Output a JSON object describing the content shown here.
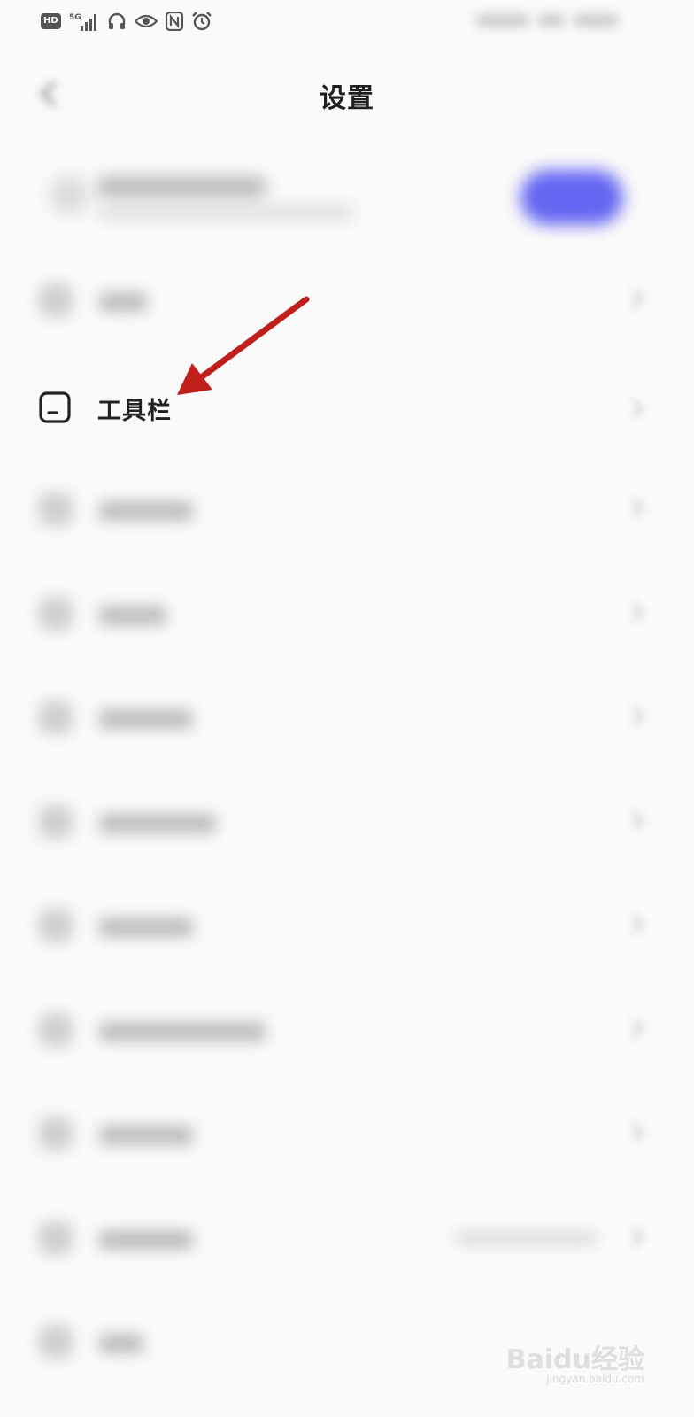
{
  "status_bar": {
    "hd_badge": "HD",
    "network_label": "5G",
    "icons": [
      "hd-icon",
      "signal-5g-icon",
      "headphones-icon",
      "eye-icon",
      "nfc-icon",
      "alarm-icon"
    ]
  },
  "header": {
    "title": "设置",
    "back_icon": "back-arrow-icon"
  },
  "account": {
    "accent_color": "#6466f2"
  },
  "settings": {
    "toolbar_label": "工具栏",
    "toolbar_icon": "toolbar-icon",
    "annotation_color": "#c0201c"
  },
  "watermark": {
    "main": "Baidu经验",
    "sub": "jingyan.baidu.com"
  }
}
